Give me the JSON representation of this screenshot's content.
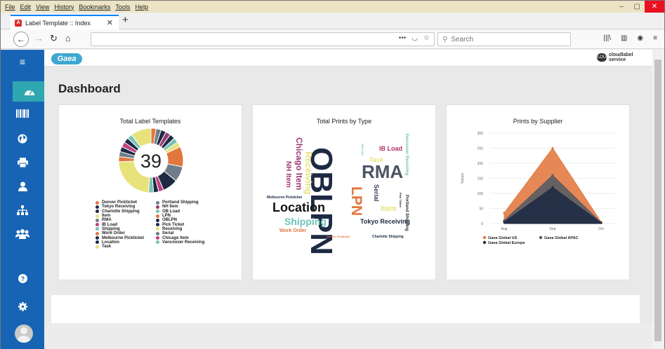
{
  "browser": {
    "menu": [
      "File",
      "Edit",
      "View",
      "History",
      "Bookmarks",
      "Tools",
      "Help"
    ],
    "tab_title": "Label Template :: Index",
    "tab_favicon": "A",
    "search_placeholder": "Search",
    "window_controls": {
      "minimize": "–",
      "maximize": "▢",
      "close": "✕"
    }
  },
  "app": {
    "logo": "Gaea",
    "brand_right": "cloudlabel service",
    "brand_icon_text": "CLOUD",
    "page_title": "Dashboard",
    "sidebar": [
      {
        "name": "menu-icon",
        "glyph": "≡"
      },
      {
        "name": "dashboard-icon",
        "glyph": "◔"
      },
      {
        "name": "barcode-icon",
        "glyph": "▮▮▮"
      },
      {
        "name": "globe-icon",
        "glyph": "●"
      },
      {
        "name": "printer-icon",
        "glyph": "⎙"
      },
      {
        "name": "user-icon",
        "glyph": "●"
      },
      {
        "name": "sitemap-icon",
        "glyph": "⊥"
      },
      {
        "name": "users-icon",
        "glyph": "●●"
      },
      {
        "name": "help-icon",
        "glyph": "?"
      },
      {
        "name": "settings-icon",
        "glyph": "⚙"
      }
    ]
  },
  "cards": {
    "labels": {
      "title": "Total Label Templates",
      "total": "39",
      "legend": [
        {
          "name": "Denver Pickticket",
          "color": "#e2773e"
        },
        {
          "name": "Portland Shipping",
          "color": "#6f7c8a"
        },
        {
          "name": "Tokyo Receiving",
          "color": "#1e2a44"
        },
        {
          "name": "NH Item",
          "color": "#9a3a72"
        },
        {
          "name": "Charlotte Shipping",
          "color": "#1e2a44"
        },
        {
          "name": "OB Load",
          "color": "#7ac3b5"
        },
        {
          "name": "Item",
          "color": "#e7e27a"
        },
        {
          "name": "LPN",
          "color": "#e2773e"
        },
        {
          "name": "RMA",
          "color": "#6f7c8a"
        },
        {
          "name": "OBLPN",
          "color": "#1e2a44"
        },
        {
          "name": "IB Load",
          "color": "#c04080"
        },
        {
          "name": "Pick Ticket",
          "color": "#1e2a44"
        },
        {
          "name": "Shipping",
          "color": "#7ac3b5"
        },
        {
          "name": "Receiving",
          "color": "#e7e27a"
        },
        {
          "name": "Work Order",
          "color": "#e2773e"
        },
        {
          "name": "Serial",
          "color": "#6f7c8a"
        },
        {
          "name": "Melbourne Pickticket",
          "color": "#1e2a44"
        },
        {
          "name": "Chicago Item",
          "color": "#c04080"
        },
        {
          "name": "Location",
          "color": "#1e2a44"
        },
        {
          "name": "Vancouver Receiving",
          "color": "#7ac3b5"
        },
        {
          "name": "Task",
          "color": "#e7e27a"
        }
      ]
    },
    "prints_by_type": {
      "title": "Total Prints by Type",
      "words": [
        {
          "text": "OBLPN",
          "color": "#1e2a44"
        },
        {
          "text": "RMA",
          "color": "#4a5563"
        },
        {
          "text": "Location",
          "color": "#111111"
        },
        {
          "text": "LPN",
          "color": "#e2773e"
        },
        {
          "text": "Shipping",
          "color": "#6fc3b8"
        },
        {
          "text": "Chicago Item",
          "color": "#a03a78"
        },
        {
          "text": "Receiving",
          "color": "#e7e27a"
        },
        {
          "text": "NH Item",
          "color": "#a03a78"
        },
        {
          "text": "IB Load",
          "color": "#b0306a"
        },
        {
          "text": "Task",
          "color": "#e7e27a"
        },
        {
          "text": "Tokyo Receiving",
          "color": "#1e2a44"
        },
        {
          "text": "Item",
          "color": "#e7e27a"
        },
        {
          "text": "Serial",
          "color": "#3a4553"
        },
        {
          "text": "Work Order",
          "color": "#e2773e"
        },
        {
          "text": "Melbourne Pickticket",
          "color": "#1e2a44"
        },
        {
          "text": "Charlotte Shipping",
          "color": "#1e2a44"
        },
        {
          "text": "Denver Pickticket",
          "color": "#e2773e"
        },
        {
          "text": "Vancouver Receiving",
          "color": "#7ac3b5"
        },
        {
          "text": "Portland Shipping",
          "color": "#333333"
        },
        {
          "text": "OB Load",
          "color": "#6fc3b8"
        },
        {
          "text": "Pick Ticket",
          "color": "#222222"
        }
      ]
    },
    "prints_by_supplier": {
      "title": "Prints by Supplier"
    }
  },
  "chart_data": [
    {
      "type": "pie",
      "title": "Total Label Templates",
      "center_label": "39",
      "categories": [
        "Denver Pickticket",
        "Portland Shipping",
        "Tokyo Receiving",
        "NH Item",
        "Charlotte Shipping",
        "OB Load",
        "Item",
        "LPN",
        "RMA",
        "OBLPN",
        "IB Load",
        "Pick Ticket",
        "Shipping",
        "Receiving",
        "Work Order",
        "Serial",
        "Melbourne Pickticket",
        "Chicago Item",
        "Location",
        "Vancouver Receiving",
        "Task"
      ],
      "values": [
        1,
        1,
        1,
        1,
        1,
        1,
        1,
        4,
        3,
        3,
        1,
        1,
        1,
        9,
        1,
        1,
        1,
        1,
        1,
        1,
        4
      ]
    },
    {
      "type": "area",
      "title": "Prints by Supplier",
      "categories": [
        "Aug",
        "Sep",
        "Oct"
      ],
      "ylabel": "Values",
      "ylim": [
        0,
        300
      ],
      "yticks": [
        0,
        50,
        100,
        150,
        200,
        250,
        300
      ],
      "series": [
        {
          "name": "Gaea Global US",
          "values": [
            35,
            250,
            5
          ],
          "color": "#e2773e"
        },
        {
          "name": "Gaea Global APAC",
          "values": [
            10,
            160,
            3
          ],
          "color": "#555a63"
        },
        {
          "name": "Gaea Global Europe",
          "values": [
            5,
            120,
            2
          ],
          "color": "#1e2a44"
        }
      ],
      "legend": "bottom"
    }
  ]
}
